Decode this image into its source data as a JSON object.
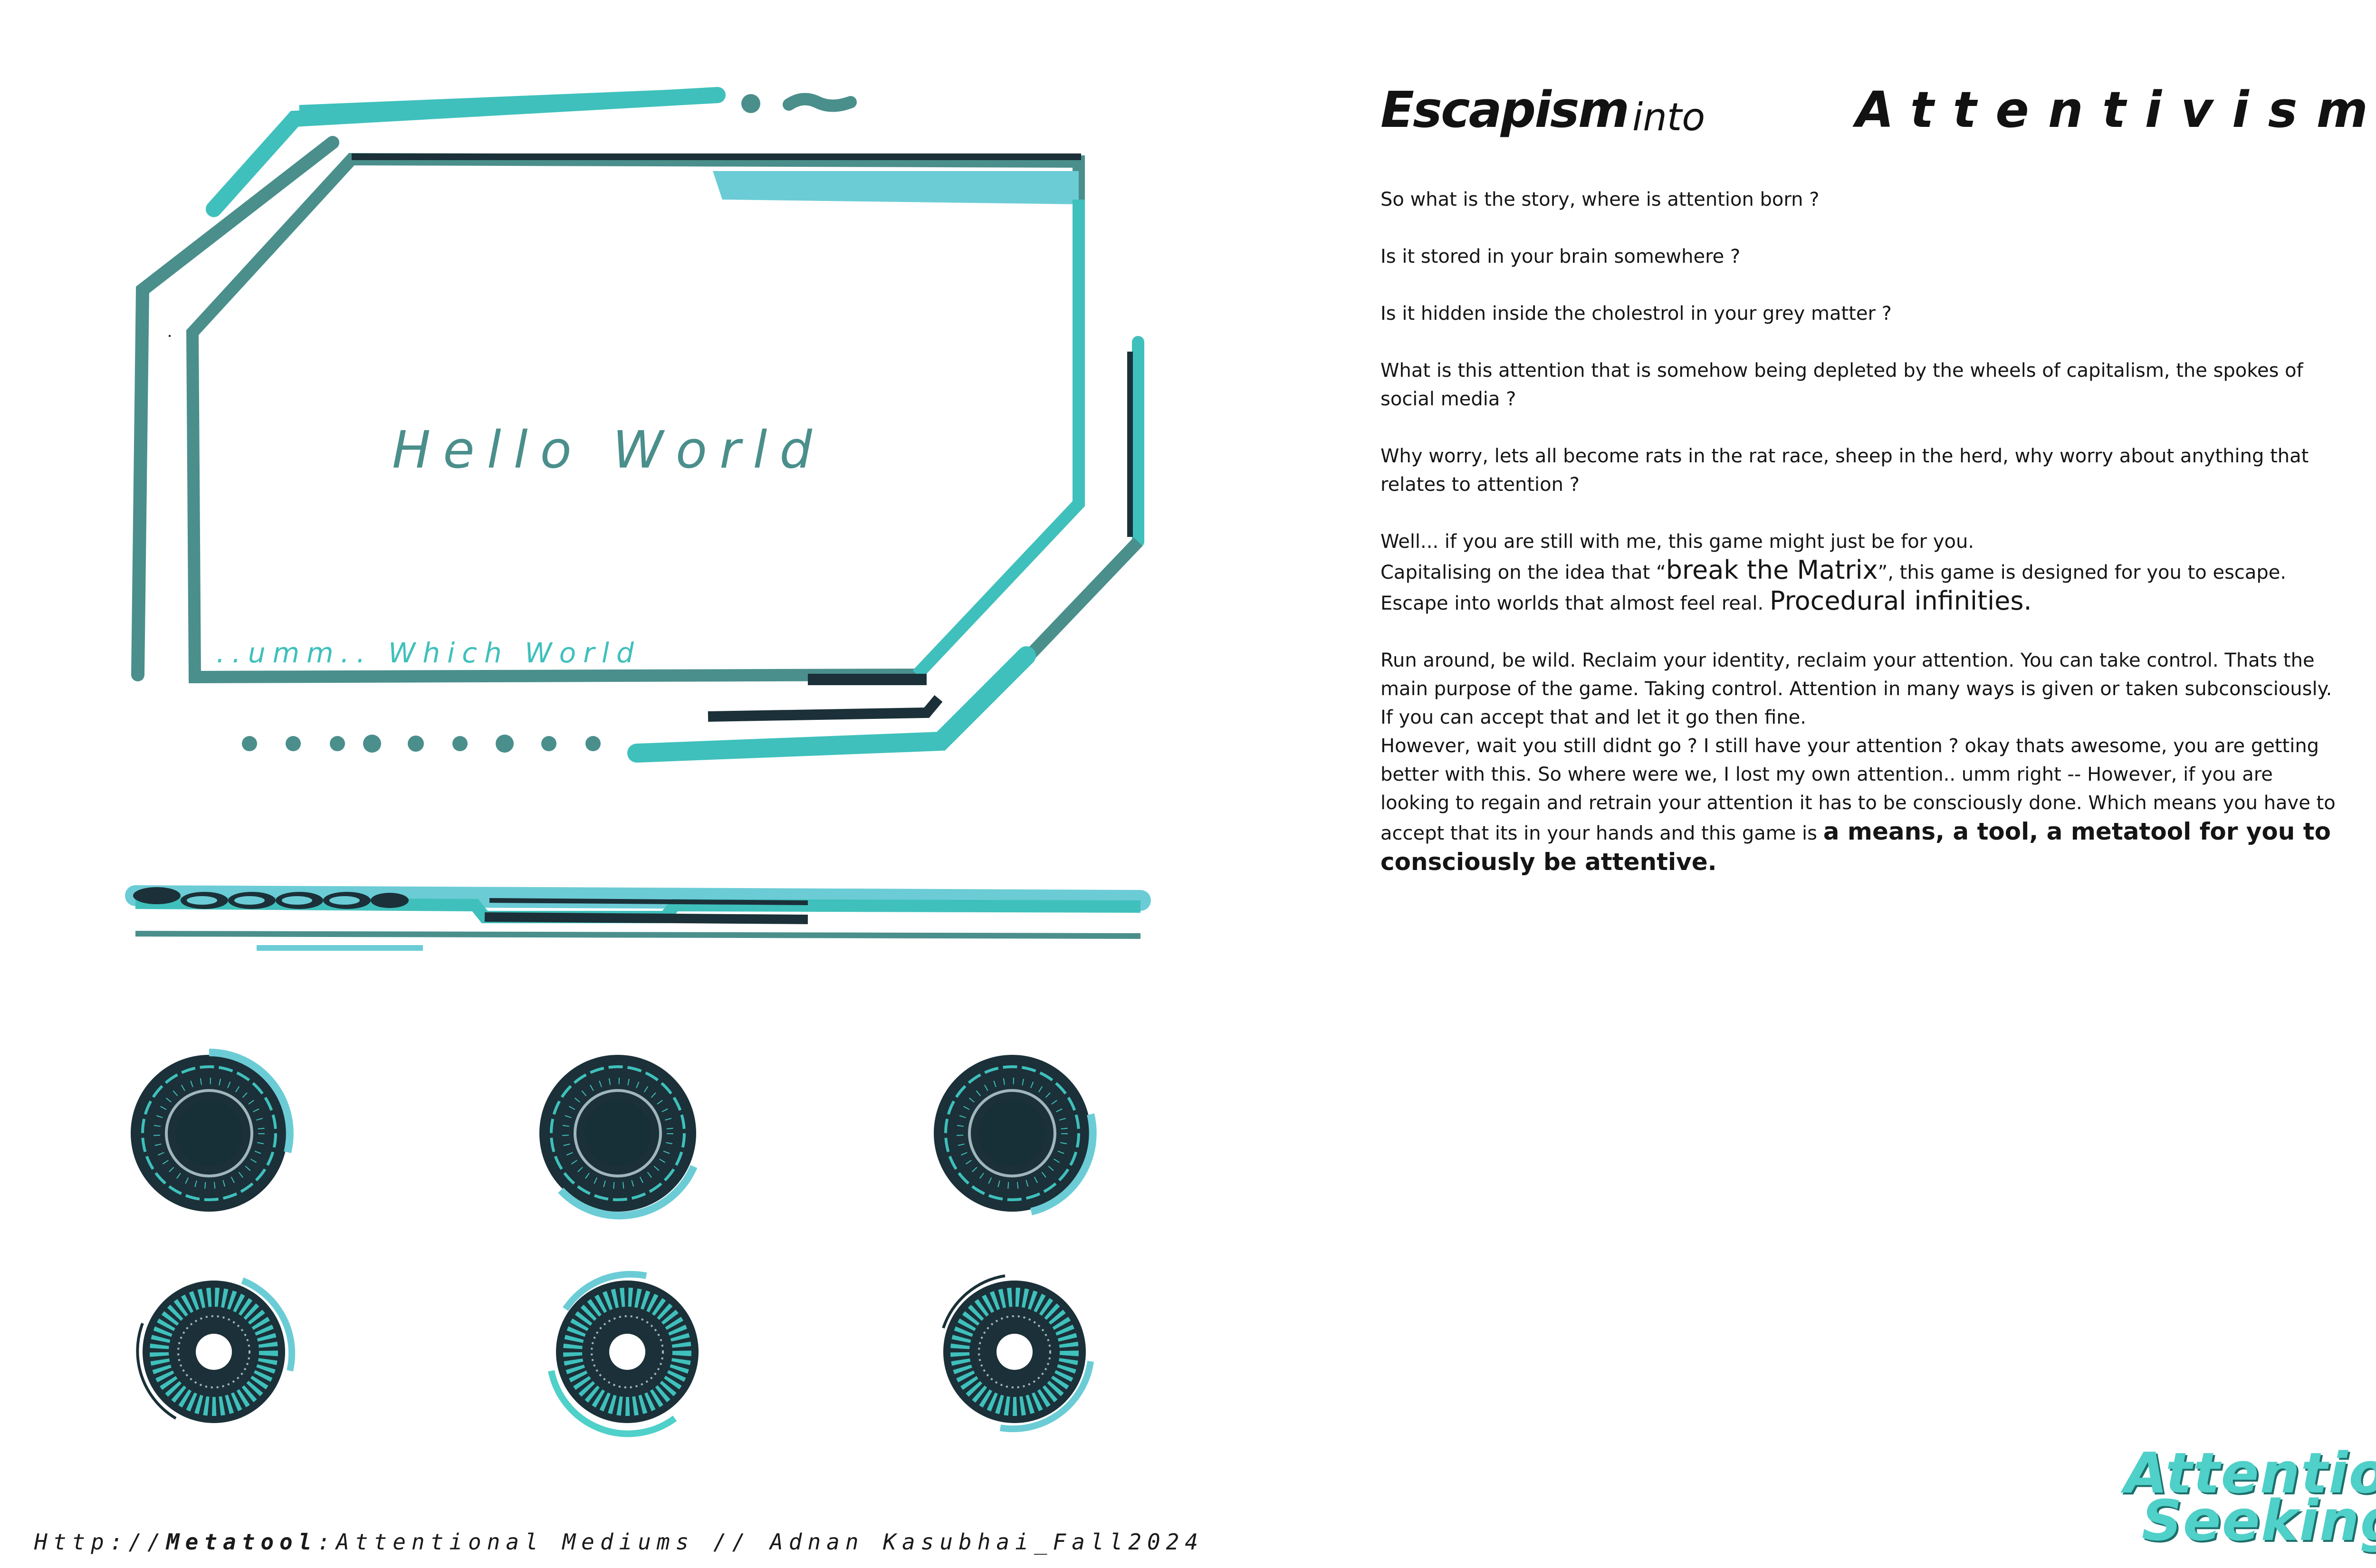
{
  "frame": {
    "hello": "Hello World",
    "which": "..umm.. Which World"
  },
  "heading": {
    "part1": "Escapism",
    "part2": "into",
    "part3": "Attentivism"
  },
  "paragraphs": {
    "p1": "So what is the story, where is attention born ?",
    "p2": "Is it stored in your brain somewhere ?",
    "p3": "Is it hidden inside the cholestrol in your grey matter ?",
    "p4": "What is this attention that is somehow being depleted by the wheels of capitalism, the spokes of social media ?",
    "p5": "Why worry, lets all become rats in the rat race, sheep in the herd, why worry about anything that relates to attention ?",
    "p6": "Well... if you are still with me, this game might just be for you.",
    "p7a": "Capitalising on the idea that “",
    "p7b": "break the Matrix",
    "p7c": "”, this game is designed for you to escape.",
    "p8a": "Escape into worlds that almost feel real. ",
    "p8b": "Procedural infinities.",
    "p9": "Run around, be wild. Reclaim your identity, reclaim your attention. You can take control. Thats the main purpose of the game. Taking control. Attention in many ways is given or taken subconsciously. If you can accept that and let it go then fine.",
    "p10a": "However, wait you still didnt go ? I still have your attention ? okay thats awesome, you are getting better with this. So where were we, I lost my own attention.. umm right -- However, if you are looking to regain and retrain your attention it has to be consciously done. Which means you have to accept that its in your hands and this game is ",
    "p10b": "a means, a tool, a metatool for you to consciously be attentive."
  },
  "footer": {
    "prefix": "Http://",
    "bold": "Metatool",
    "suffix": ":Attentional Mediums // Adnan Kasubhai_Fall2024"
  },
  "logo": {
    "line1": "Attention",
    "line2": "Seeking"
  },
  "colors": {
    "teal": "#3fc0bc",
    "light_teal": "#6bccd6",
    "dark_teal": "#4a8f8c",
    "navy": "#1b3038"
  }
}
